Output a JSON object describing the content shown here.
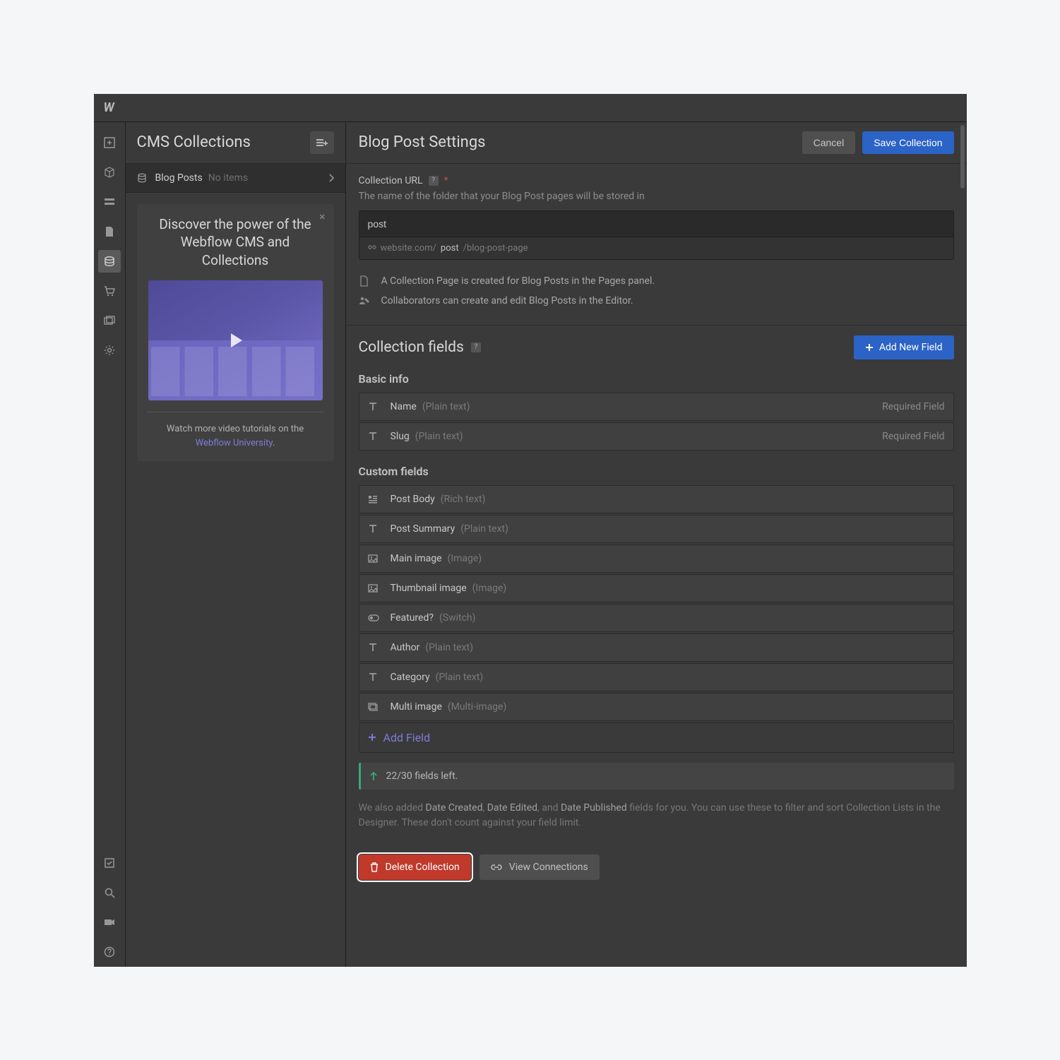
{
  "sidebar": {
    "title": "CMS Collections",
    "item": {
      "name": "Blog Posts",
      "count": "No items"
    },
    "promo": {
      "title": "Discover the power of the Webflow CMS and Collections",
      "footer_pre": "Watch more video tutorials on the ",
      "footer_link": "Webflow University",
      "footer_post": "."
    }
  },
  "header": {
    "title": "Blog Post Settings",
    "cancel": "Cancel",
    "save": "Save Collection"
  },
  "url": {
    "label": "Collection URL",
    "desc": "The name of the folder that your Blog Post pages will be stored in",
    "value": "post",
    "preview_host": "website.com/",
    "preview_slug": "post",
    "preview_tail": "/blog-post-page"
  },
  "info": {
    "row1": "A Collection Page is created for Blog Posts in the Pages panel.",
    "row2": "Collaborators can create and edit Blog Posts in the Editor."
  },
  "fields": {
    "heading": "Collection fields",
    "add_new": "Add New Field",
    "basic_label": "Basic info",
    "basic": [
      {
        "name": "Name",
        "type": "(Plain text)",
        "req": "Required Field",
        "icon": "T"
      },
      {
        "name": "Slug",
        "type": "(Plain text)",
        "req": "Required Field",
        "icon": "T"
      }
    ],
    "custom_label": "Custom fields",
    "custom": [
      {
        "name": "Post Body",
        "type": "(Rich text)",
        "icon": "rich"
      },
      {
        "name": "Post Summary",
        "type": "(Plain text)",
        "icon": "T"
      },
      {
        "name": "Main image",
        "type": "(Image)",
        "icon": "img"
      },
      {
        "name": "Thumbnail image",
        "type": "(Image)",
        "icon": "img"
      },
      {
        "name": "Featured?",
        "type": "(Switch)",
        "icon": "switch"
      },
      {
        "name": "Author",
        "type": "(Plain text)",
        "icon": "T"
      },
      {
        "name": "Category",
        "type": "(Plain text)",
        "icon": "T"
      },
      {
        "name": "Multi image",
        "type": "(Multi-image)",
        "icon": "multi"
      }
    ],
    "add_field": "Add Field",
    "left": "22/30 fields left."
  },
  "footer_note": {
    "pre": "We also added ",
    "d1": "Date Created",
    "sep1": ", ",
    "d2": "Date Edited",
    "sep2": ", and ",
    "d3": "Date Published",
    "post": " fields for you. You can use these to filter and sort Collection Lists in the Designer. These don't count against your field limit."
  },
  "actions": {
    "delete": "Delete Collection",
    "view": "View Connections"
  }
}
